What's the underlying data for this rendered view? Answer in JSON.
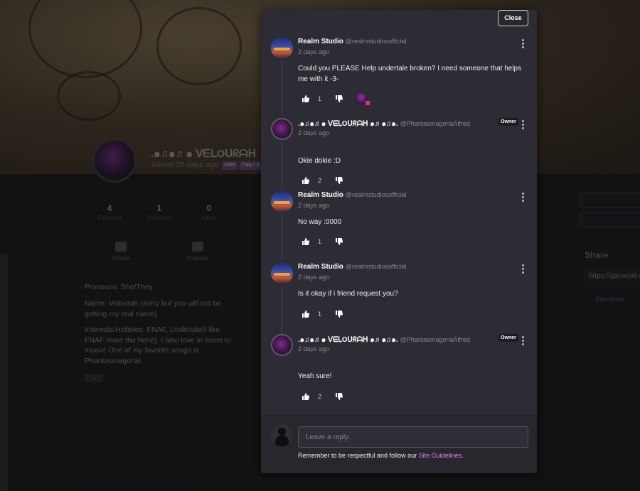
{
  "background": {
    "profile": {
      "name": ".๑♫๑♬๑ ᐯᗴᒪOᑌᖇᗩᕼ",
      "joined": "Joined 26 days ago",
      "tags": [
        "GMR",
        "They / S"
      ]
    },
    "stats": [
      {
        "value": "4",
        "label": "Following"
      },
      {
        "value": "1",
        "label": "Followers"
      },
      {
        "value": "0",
        "label": "Likes"
      }
    ],
    "tabs": [
      {
        "label": "Shouts",
        "icon": "chat-bubble-icon"
      },
      {
        "label": "Trophies",
        "icon": "trophy-icon"
      }
    ],
    "bio": {
      "pronouns": "Pronouns: She/They",
      "name_line": "Name: Velourah (sorry but you will not be getting my real name)",
      "interests": "Interests/Hobbies: FNAF, Undertale(I like FNAF more tho hehe). I also love to listen to music! One of my favorite songs is Phantasmagoria!",
      "more": "..."
    },
    "share": {
      "heading": "Share",
      "url": "https://gamejolt.c",
      "facebook": "Facebook"
    }
  },
  "modal": {
    "close_label": "Close",
    "comments": [
      {
        "name": "Realm Studio",
        "handle": "@realmstudiosofficial",
        "time": "2 days ago",
        "owner": false,
        "text": "Could you PLEASE Help undertale broken? I need someone that helps me with it -3-",
        "likes": "1",
        "has_liker": true
      },
      {
        "name": ".๑♫๑♬๑ ᐯᗴᒪOᑌᖇᗩᕼ ๑♬๑♫๑.",
        "handle": "@PhantasmagoriaAlfred",
        "time": "2 days ago",
        "owner": true,
        "owner_label": "Owner",
        "text": "Okie dokie :D",
        "likes": "2",
        "has_liker": false
      },
      {
        "name": "Realm Studio",
        "handle": "@realmstudiosofficial",
        "time": "2 days ago",
        "owner": false,
        "text": "No way :0000",
        "likes": "1",
        "has_liker": false
      },
      {
        "name": "Realm Studio",
        "handle": "@realmstudiosofficial",
        "time": "2 days ago",
        "owner": false,
        "text": "Is it okay if i friend request you?",
        "likes": "1",
        "has_liker": false
      },
      {
        "name": ".๑♫๑♬๑ ᐯᗴᒪOᑌᖇᗩᕼ ๑♬๑♫๑.",
        "handle": "@PhantasmagoriaAlfred",
        "time": "2 days ago",
        "owner": true,
        "owner_label": "Owner",
        "text": "Yeah sure!",
        "likes": "2",
        "has_liker": false
      }
    ],
    "reply": {
      "placeholder": "Leave a reply...",
      "guidelines_text": "Remember to be respectful and follow our ",
      "guidelines_link": "Site Guidelines",
      "guidelines_end": "."
    }
  }
}
